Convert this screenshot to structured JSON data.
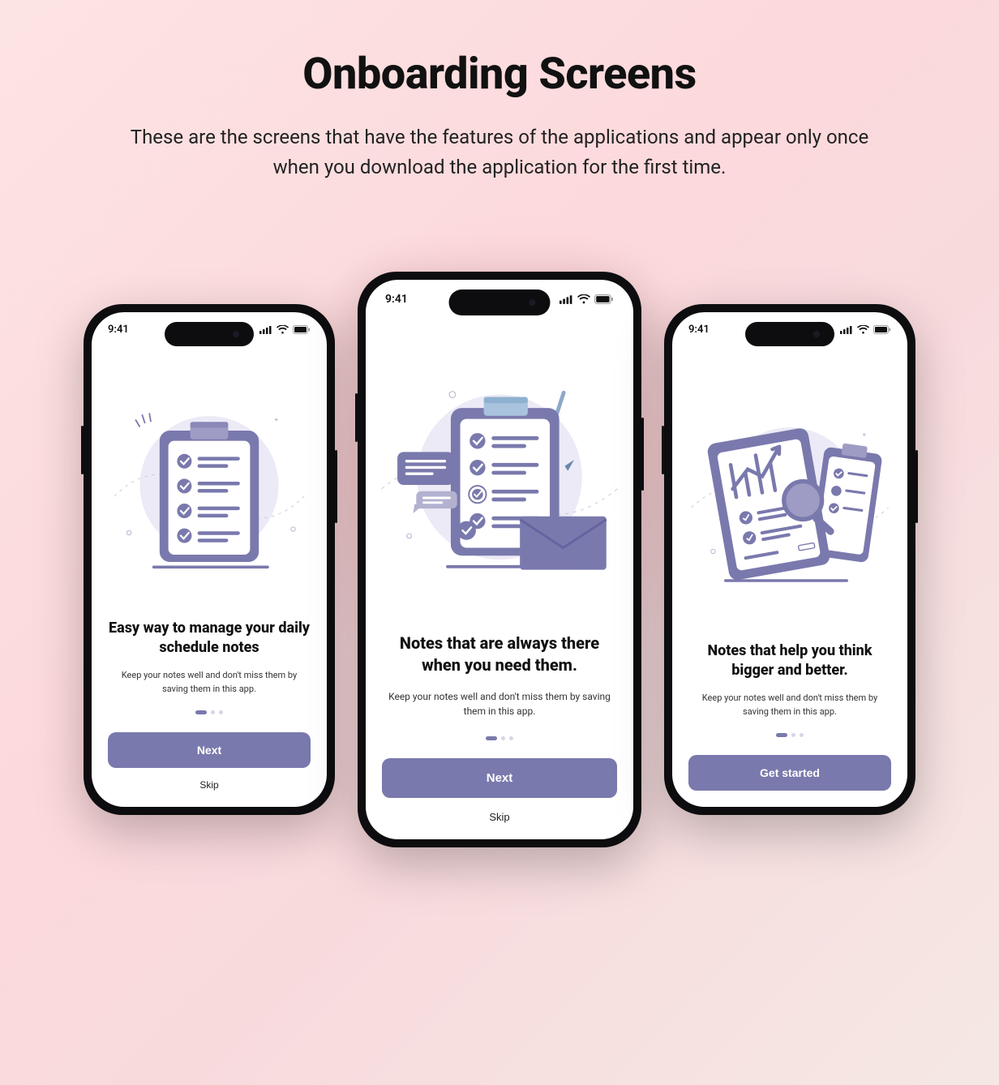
{
  "header": {
    "title": "Onboarding Screens",
    "subtitle": "These are the screens that have the features of the applications and appear only  once when you download the application for the first time."
  },
  "status_time": "9:41",
  "screens": [
    {
      "title": "Easy way to manage your daily schedule notes",
      "description": "Keep your notes well and don't miss them by saving them in this app.",
      "primary_label": "Next",
      "skip_label": "Skip",
      "active_dot": 0,
      "show_skip": true
    },
    {
      "title": "Notes that are always there when you need them.",
      "description": "Keep your notes well and don't miss them by saving them in this app.",
      "primary_label": "Next",
      "skip_label": "Skip",
      "active_dot": 0,
      "show_skip": true
    },
    {
      "title": "Notes that help you think bigger and better.",
      "description": "Keep your notes well and don't miss them by saving them in this app.",
      "primary_label": "Get started",
      "skip_label": "",
      "active_dot": 0,
      "show_skip": false
    }
  ]
}
